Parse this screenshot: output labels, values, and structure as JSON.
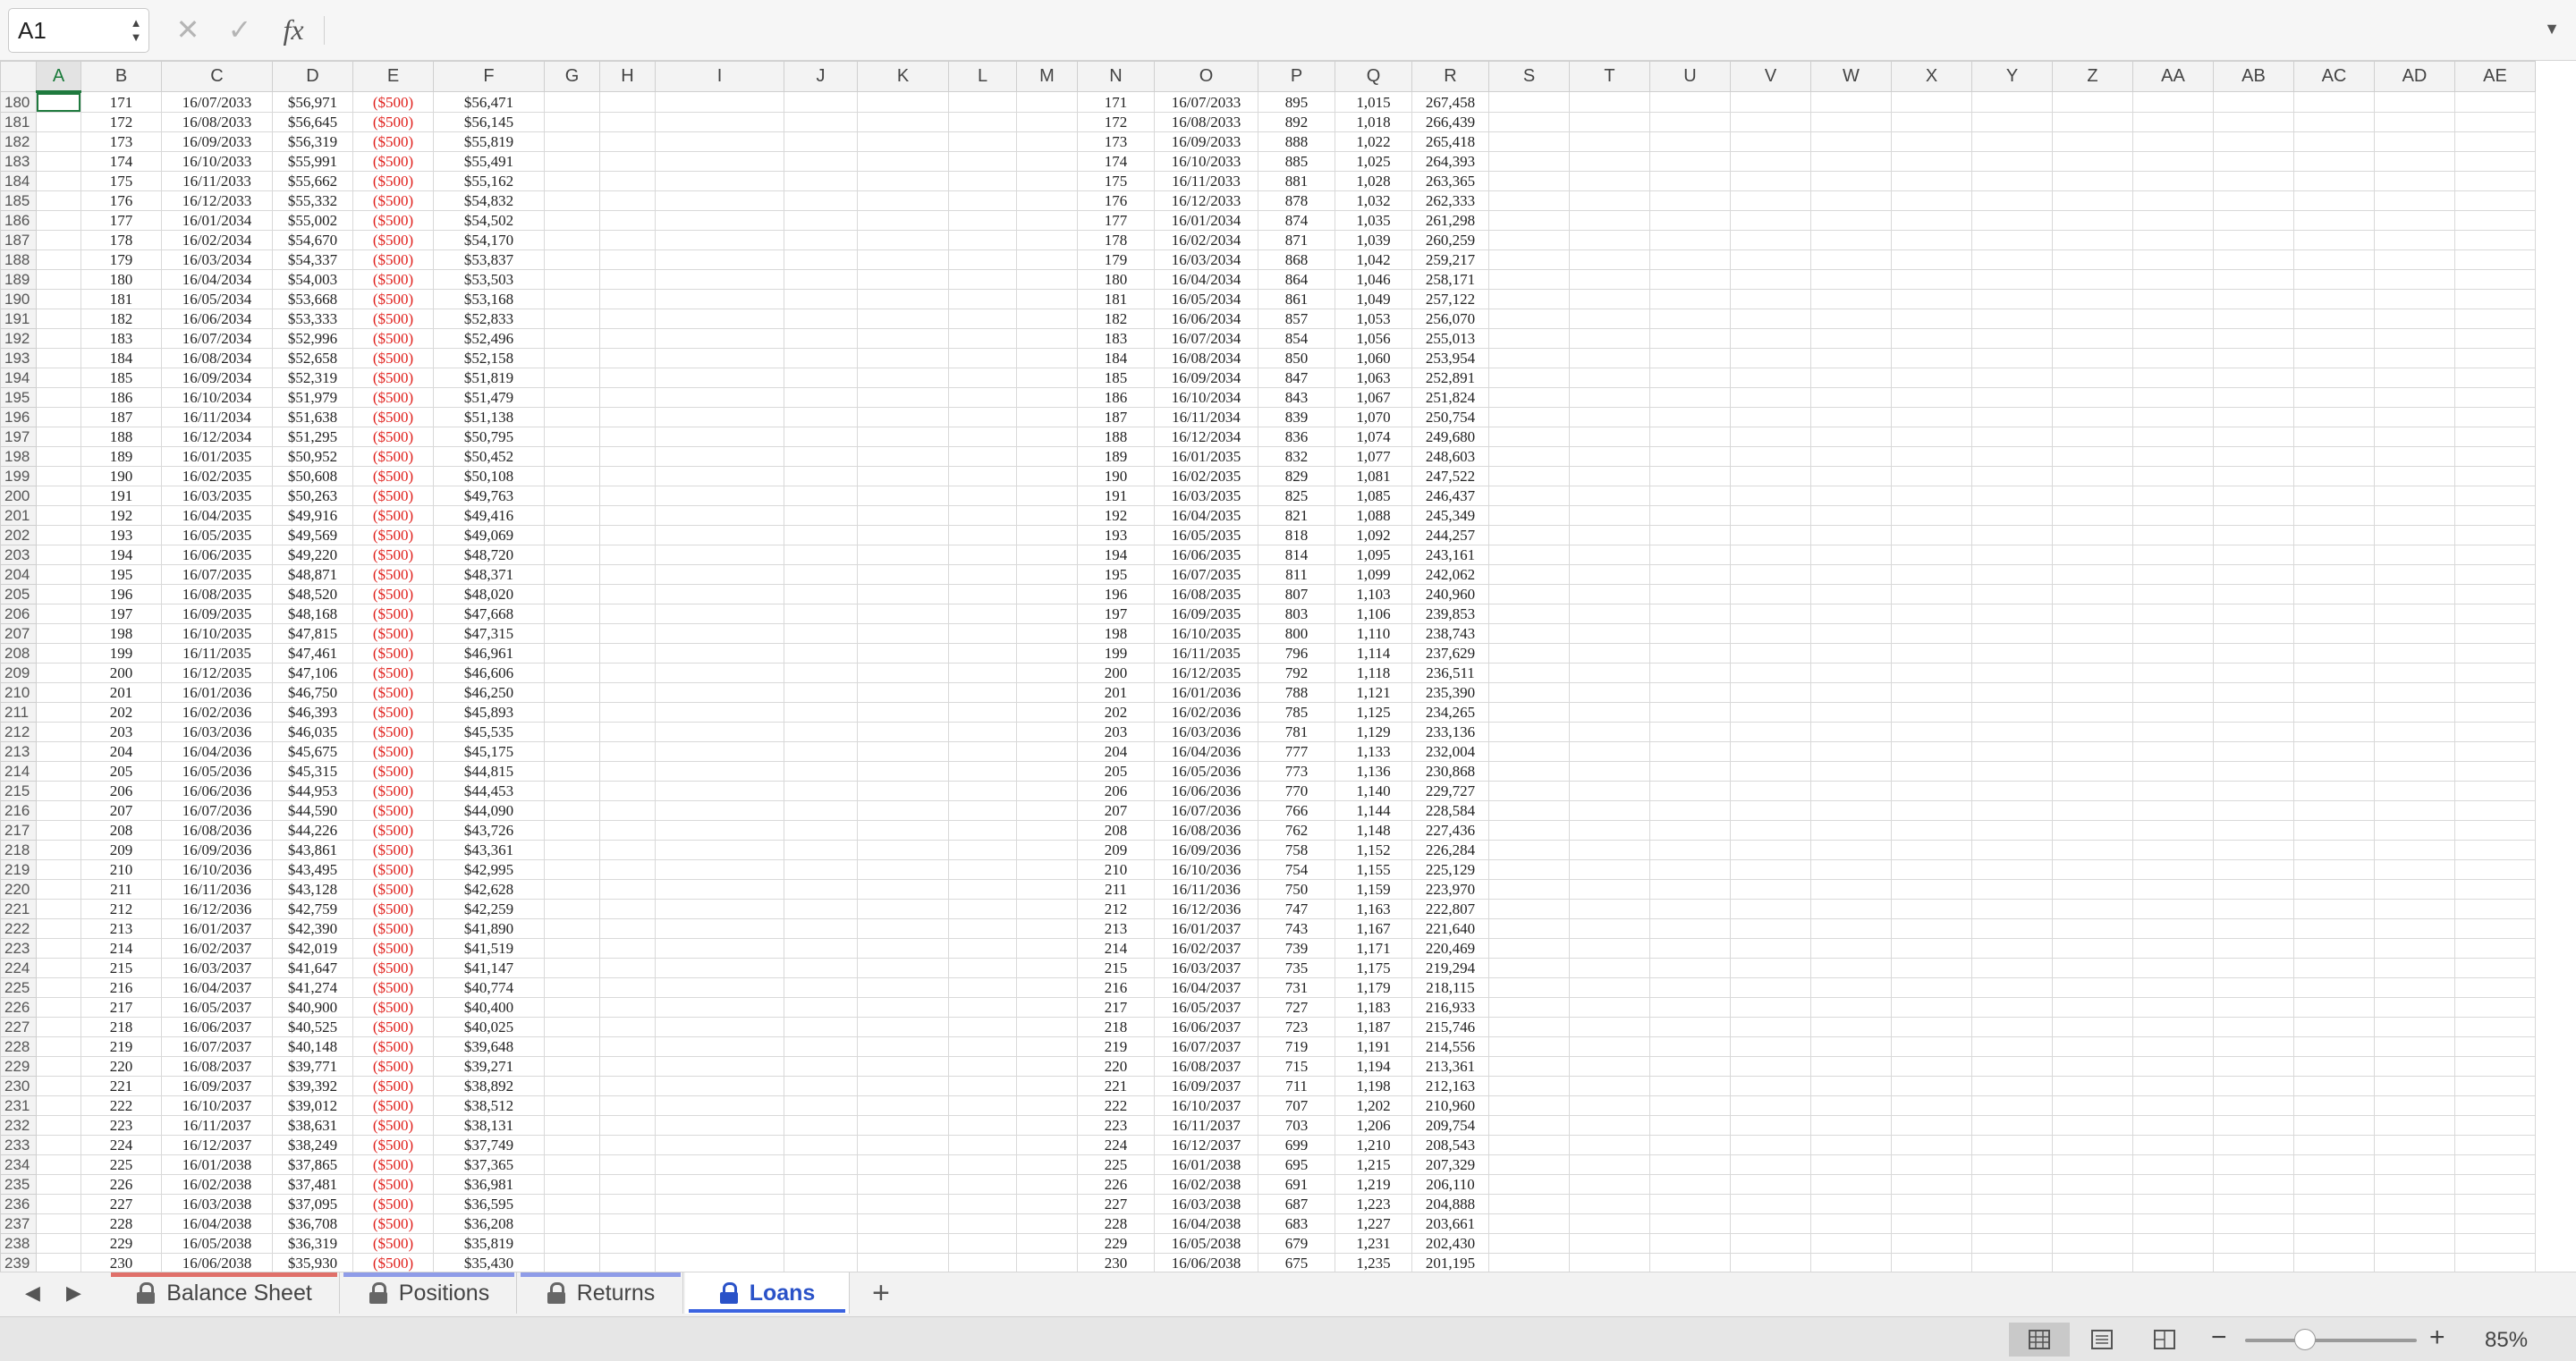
{
  "formula_bar": {
    "name_box": "A1",
    "formula": "",
    "fx_label": "fx"
  },
  "columns": [
    "A",
    "B",
    "C",
    "D",
    "E",
    "F",
    "G",
    "H",
    "I",
    "J",
    "K",
    "L",
    "M",
    "N",
    "O",
    "P",
    "Q",
    "R",
    "S",
    "T",
    "U",
    "V",
    "W",
    "X",
    "Y",
    "Z",
    "AA",
    "AB",
    "AC",
    "AD",
    "AE"
  ],
  "left_table": [
    [
      "171",
      "16/07/2033",
      "$56,971",
      "($500)",
      "$56,471"
    ],
    [
      "172",
      "16/08/2033",
      "$56,645",
      "($500)",
      "$56,145"
    ],
    [
      "173",
      "16/09/2033",
      "$56,319",
      "($500)",
      "$55,819"
    ],
    [
      "174",
      "16/10/2033",
      "$55,991",
      "($500)",
      "$55,491"
    ],
    [
      "175",
      "16/11/2033",
      "$55,662",
      "($500)",
      "$55,162"
    ],
    [
      "176",
      "16/12/2033",
      "$55,332",
      "($500)",
      "$54,832"
    ],
    [
      "177",
      "16/01/2034",
      "$55,002",
      "($500)",
      "$54,502"
    ],
    [
      "178",
      "16/02/2034",
      "$54,670",
      "($500)",
      "$54,170"
    ],
    [
      "179",
      "16/03/2034",
      "$54,337",
      "($500)",
      "$53,837"
    ],
    [
      "180",
      "16/04/2034",
      "$54,003",
      "($500)",
      "$53,503"
    ],
    [
      "181",
      "16/05/2034",
      "$53,668",
      "($500)",
      "$53,168"
    ],
    [
      "182",
      "16/06/2034",
      "$53,333",
      "($500)",
      "$52,833"
    ],
    [
      "183",
      "16/07/2034",
      "$52,996",
      "($500)",
      "$52,496"
    ],
    [
      "184",
      "16/08/2034",
      "$52,658",
      "($500)",
      "$52,158"
    ],
    [
      "185",
      "16/09/2034",
      "$52,319",
      "($500)",
      "$51,819"
    ],
    [
      "186",
      "16/10/2034",
      "$51,979",
      "($500)",
      "$51,479"
    ],
    [
      "187",
      "16/11/2034",
      "$51,638",
      "($500)",
      "$51,138"
    ],
    [
      "188",
      "16/12/2034",
      "$51,295",
      "($500)",
      "$50,795"
    ],
    [
      "189",
      "16/01/2035",
      "$50,952",
      "($500)",
      "$50,452"
    ],
    [
      "190",
      "16/02/2035",
      "$50,608",
      "($500)",
      "$50,108"
    ],
    [
      "191",
      "16/03/2035",
      "$50,263",
      "($500)",
      "$49,763"
    ],
    [
      "192",
      "16/04/2035",
      "$49,916",
      "($500)",
      "$49,416"
    ],
    [
      "193",
      "16/05/2035",
      "$49,569",
      "($500)",
      "$49,069"
    ],
    [
      "194",
      "16/06/2035",
      "$49,220",
      "($500)",
      "$48,720"
    ],
    [
      "195",
      "16/07/2035",
      "$48,871",
      "($500)",
      "$48,371"
    ],
    [
      "196",
      "16/08/2035",
      "$48,520",
      "($500)",
      "$48,020"
    ],
    [
      "197",
      "16/09/2035",
      "$48,168",
      "($500)",
      "$47,668"
    ],
    [
      "198",
      "16/10/2035",
      "$47,815",
      "($500)",
      "$47,315"
    ],
    [
      "199",
      "16/11/2035",
      "$47,461",
      "($500)",
      "$46,961"
    ],
    [
      "200",
      "16/12/2035",
      "$47,106",
      "($500)",
      "$46,606"
    ],
    [
      "201",
      "16/01/2036",
      "$46,750",
      "($500)",
      "$46,250"
    ],
    [
      "202",
      "16/02/2036",
      "$46,393",
      "($500)",
      "$45,893"
    ],
    [
      "203",
      "16/03/2036",
      "$46,035",
      "($500)",
      "$45,535"
    ],
    [
      "204",
      "16/04/2036",
      "$45,675",
      "($500)",
      "$45,175"
    ],
    [
      "205",
      "16/05/2036",
      "$45,315",
      "($500)",
      "$44,815"
    ],
    [
      "206",
      "16/06/2036",
      "$44,953",
      "($500)",
      "$44,453"
    ],
    [
      "207",
      "16/07/2036",
      "$44,590",
      "($500)",
      "$44,090"
    ],
    [
      "208",
      "16/08/2036",
      "$44,226",
      "($500)",
      "$43,726"
    ],
    [
      "209",
      "16/09/2036",
      "$43,861",
      "($500)",
      "$43,361"
    ],
    [
      "210",
      "16/10/2036",
      "$43,495",
      "($500)",
      "$42,995"
    ],
    [
      "211",
      "16/11/2036",
      "$43,128",
      "($500)",
      "$42,628"
    ],
    [
      "212",
      "16/12/2036",
      "$42,759",
      "($500)",
      "$42,259"
    ],
    [
      "213",
      "16/01/2037",
      "$42,390",
      "($500)",
      "$41,890"
    ],
    [
      "214",
      "16/02/2037",
      "$42,019",
      "($500)",
      "$41,519"
    ],
    [
      "215",
      "16/03/2037",
      "$41,647",
      "($500)",
      "$41,147"
    ],
    [
      "216",
      "16/04/2037",
      "$41,274",
      "($500)",
      "$40,774"
    ],
    [
      "217",
      "16/05/2037",
      "$40,900",
      "($500)",
      "$40,400"
    ],
    [
      "218",
      "16/06/2037",
      "$40,525",
      "($500)",
      "$40,025"
    ],
    [
      "219",
      "16/07/2037",
      "$40,148",
      "($500)",
      "$39,648"
    ],
    [
      "220",
      "16/08/2037",
      "$39,771",
      "($500)",
      "$39,271"
    ],
    [
      "221",
      "16/09/2037",
      "$39,392",
      "($500)",
      "$38,892"
    ],
    [
      "222",
      "16/10/2037",
      "$39,012",
      "($500)",
      "$38,512"
    ],
    [
      "223",
      "16/11/2037",
      "$38,631",
      "($500)",
      "$38,131"
    ],
    [
      "224",
      "16/12/2037",
      "$38,249",
      "($500)",
      "$37,749"
    ],
    [
      "225",
      "16/01/2038",
      "$37,865",
      "($500)",
      "$37,365"
    ],
    [
      "226",
      "16/02/2038",
      "$37,481",
      "($500)",
      "$36,981"
    ],
    [
      "227",
      "16/03/2038",
      "$37,095",
      "($500)",
      "$36,595"
    ],
    [
      "228",
      "16/04/2038",
      "$36,708",
      "($500)",
      "$36,208"
    ],
    [
      "229",
      "16/05/2038",
      "$36,319",
      "($500)",
      "$35,819"
    ],
    [
      "230",
      "16/06/2038",
      "$35,930",
      "($500)",
      "$35,430"
    ]
  ],
  "right_table": [
    [
      "171",
      "16/07/2033",
      "895",
      "1,015",
      "267,458"
    ],
    [
      "172",
      "16/08/2033",
      "892",
      "1,018",
      "266,439"
    ],
    [
      "173",
      "16/09/2033",
      "888",
      "1,022",
      "265,418"
    ],
    [
      "174",
      "16/10/2033",
      "885",
      "1,025",
      "264,393"
    ],
    [
      "175",
      "16/11/2033",
      "881",
      "1,028",
      "263,365"
    ],
    [
      "176",
      "16/12/2033",
      "878",
      "1,032",
      "262,333"
    ],
    [
      "177",
      "16/01/2034",
      "874",
      "1,035",
      "261,298"
    ],
    [
      "178",
      "16/02/2034",
      "871",
      "1,039",
      "260,259"
    ],
    [
      "179",
      "16/03/2034",
      "868",
      "1,042",
      "259,217"
    ],
    [
      "180",
      "16/04/2034",
      "864",
      "1,046",
      "258,171"
    ],
    [
      "181",
      "16/05/2034",
      "861",
      "1,049",
      "257,122"
    ],
    [
      "182",
      "16/06/2034",
      "857",
      "1,053",
      "256,070"
    ],
    [
      "183",
      "16/07/2034",
      "854",
      "1,056",
      "255,013"
    ],
    [
      "184",
      "16/08/2034",
      "850",
      "1,060",
      "253,954"
    ],
    [
      "185",
      "16/09/2034",
      "847",
      "1,063",
      "252,891"
    ],
    [
      "186",
      "16/10/2034",
      "843",
      "1,067",
      "251,824"
    ],
    [
      "187",
      "16/11/2034",
      "839",
      "1,070",
      "250,754"
    ],
    [
      "188",
      "16/12/2034",
      "836",
      "1,074",
      "249,680"
    ],
    [
      "189",
      "16/01/2035",
      "832",
      "1,077",
      "248,603"
    ],
    [
      "190",
      "16/02/2035",
      "829",
      "1,081",
      "247,522"
    ],
    [
      "191",
      "16/03/2035",
      "825",
      "1,085",
      "246,437"
    ],
    [
      "192",
      "16/04/2035",
      "821",
      "1,088",
      "245,349"
    ],
    [
      "193",
      "16/05/2035",
      "818",
      "1,092",
      "244,257"
    ],
    [
      "194",
      "16/06/2035",
      "814",
      "1,095",
      "243,161"
    ],
    [
      "195",
      "16/07/2035",
      "811",
      "1,099",
      "242,062"
    ],
    [
      "196",
      "16/08/2035",
      "807",
      "1,103",
      "240,960"
    ],
    [
      "197",
      "16/09/2035",
      "803",
      "1,106",
      "239,853"
    ],
    [
      "198",
      "16/10/2035",
      "800",
      "1,110",
      "238,743"
    ],
    [
      "199",
      "16/11/2035",
      "796",
      "1,114",
      "237,629"
    ],
    [
      "200",
      "16/12/2035",
      "792",
      "1,118",
      "236,511"
    ],
    [
      "201",
      "16/01/2036",
      "788",
      "1,121",
      "235,390"
    ],
    [
      "202",
      "16/02/2036",
      "785",
      "1,125",
      "234,265"
    ],
    [
      "203",
      "16/03/2036",
      "781",
      "1,129",
      "233,136"
    ],
    [
      "204",
      "16/04/2036",
      "777",
      "1,133",
      "232,004"
    ],
    [
      "205",
      "16/05/2036",
      "773",
      "1,136",
      "230,868"
    ],
    [
      "206",
      "16/06/2036",
      "770",
      "1,140",
      "229,727"
    ],
    [
      "207",
      "16/07/2036",
      "766",
      "1,144",
      "228,584"
    ],
    [
      "208",
      "16/08/2036",
      "762",
      "1,148",
      "227,436"
    ],
    [
      "209",
      "16/09/2036",
      "758",
      "1,152",
      "226,284"
    ],
    [
      "210",
      "16/10/2036",
      "754",
      "1,155",
      "225,129"
    ],
    [
      "211",
      "16/11/2036",
      "750",
      "1,159",
      "223,970"
    ],
    [
      "212",
      "16/12/2036",
      "747",
      "1,163",
      "222,807"
    ],
    [
      "213",
      "16/01/2037",
      "743",
      "1,167",
      "221,640"
    ],
    [
      "214",
      "16/02/2037",
      "739",
      "1,171",
      "220,469"
    ],
    [
      "215",
      "16/03/2037",
      "735",
      "1,175",
      "219,294"
    ],
    [
      "216",
      "16/04/2037",
      "731",
      "1,179",
      "218,115"
    ],
    [
      "217",
      "16/05/2037",
      "727",
      "1,183",
      "216,933"
    ],
    [
      "218",
      "16/06/2037",
      "723",
      "1,187",
      "215,746"
    ],
    [
      "219",
      "16/07/2037",
      "719",
      "1,191",
      "214,556"
    ],
    [
      "220",
      "16/08/2037",
      "715",
      "1,194",
      "213,361"
    ],
    [
      "221",
      "16/09/2037",
      "711",
      "1,198",
      "212,163"
    ],
    [
      "222",
      "16/10/2037",
      "707",
      "1,202",
      "210,960"
    ],
    [
      "223",
      "16/11/2037",
      "703",
      "1,206",
      "209,754"
    ],
    [
      "224",
      "16/12/2037",
      "699",
      "1,210",
      "208,543"
    ],
    [
      "225",
      "16/01/2038",
      "695",
      "1,215",
      "207,329"
    ],
    [
      "226",
      "16/02/2038",
      "691",
      "1,219",
      "206,110"
    ],
    [
      "227",
      "16/03/2038",
      "687",
      "1,223",
      "204,888"
    ],
    [
      "228",
      "16/04/2038",
      "683",
      "1,227",
      "203,661"
    ],
    [
      "229",
      "16/05/2038",
      "679",
      "1,231",
      "202,430"
    ],
    [
      "230",
      "16/06/2038",
      "675",
      "1,235",
      "201,195"
    ]
  ],
  "first_row_number": 180,
  "sheet_tabs": [
    {
      "label": "Balance Sheet",
      "locked": true,
      "color": "#e0706a"
    },
    {
      "label": "Positions",
      "locked": true,
      "color": "#8f9ce8"
    },
    {
      "label": "Returns",
      "locked": true,
      "color": "#8f9ce8"
    },
    {
      "label": "Loans",
      "locked": true,
      "active": true,
      "color": "#3b63e0"
    }
  ],
  "status_bar": {
    "zoom_level": "85%",
    "zoom_fraction": 0.35
  },
  "colors": {
    "negative": "#e0201c",
    "selection": "#1f7a3e",
    "active_tab": "#2a52c8"
  }
}
